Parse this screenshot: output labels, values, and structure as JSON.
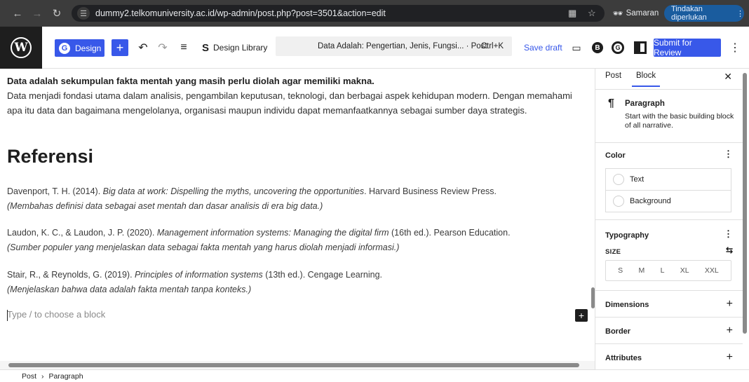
{
  "browser": {
    "url": "dummy2.telkomuniversity.ac.id/wp-admin/post.php?post=3501&action=edit",
    "incognito_label": "Samaran",
    "action_label": "Tindakan diperlukan"
  },
  "toolbar": {
    "design_label": "Design",
    "design_library_label": "Design Library",
    "document_title": "Data Adalah: Pengertian, Jenis, Fungsi... · Post",
    "shortcut": "Ctrl+K",
    "save_draft_label": "Save draft",
    "submit_label": "Submit for Review"
  },
  "content": {
    "intro_bold": "Data adalah sekumpulan fakta mentah yang masih perlu diolah agar memiliki makna.",
    "intro_text": "Data menjadi fondasi utama dalam analisis, pengambilan keputusan, teknologi, dan berbagai aspek kehidupan modern. Dengan memahami apa itu data dan bagaimana mengelolanya, organisasi maupun individu dapat memanfaatkannya sebagai sumber daya strategis.",
    "heading": "Referensi",
    "references": [
      {
        "authors": "Davenport, T. H. (2014). ",
        "title": "Big data at work: Dispelling the myths, uncovering the opportunities",
        "rest": ". Harvard Business Review Press.",
        "note": "(Membahas definisi data sebagai aset mentah dan dasar analisis di era big data.)"
      },
      {
        "authors": "Laudon, K. C., & Laudon, J. P. (2020). ",
        "title": "Management information systems: Managing the digital firm",
        "rest": " (16th ed.). Pearson Education.",
        "note": "(Sumber populer yang menjelaskan data sebagai fakta mentah yang harus diolah menjadi informasi.)"
      },
      {
        "authors": "Stair, R., & Reynolds, G. (2019). ",
        "title": "Principles of information systems",
        "rest": " (13th ed.). Cengage Learning.",
        "note": "(Menjelaskan bahwa data adalah fakta mentah tanpa konteks.)"
      }
    ],
    "placeholder": "Type / to choose a block"
  },
  "sidebar": {
    "tab_post": "Post",
    "tab_block": "Block",
    "block_name": "Paragraph",
    "block_desc": "Start with the basic building block of all narrative.",
    "color_title": "Color",
    "color_text": "Text",
    "color_background": "Background",
    "typography_title": "Typography",
    "size_label": "SIZE",
    "sizes": [
      "S",
      "M",
      "L",
      "XL",
      "XXL"
    ],
    "dimensions_title": "Dimensions",
    "border_title": "Border",
    "attributes_title": "Attributes"
  },
  "status": {
    "crumb_post": "Post",
    "crumb_paragraph": "Paragraph"
  },
  "colors": {
    "accent": "#3858e9",
    "chrome": "#3c3c3c",
    "wp_logo_bg": "#1e1e1e"
  }
}
